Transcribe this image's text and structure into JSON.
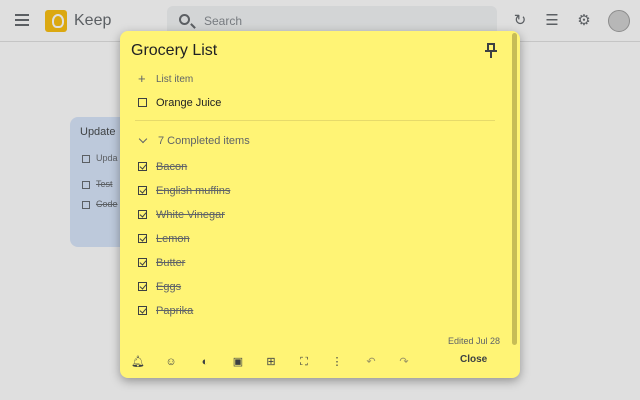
{
  "header": {
    "app_title": "Keep",
    "search_placeholder": "Search",
    "icons": [
      "menu-icon",
      "keep-logo-icon",
      "search-icon",
      "refresh-icon",
      "list-view-icon",
      "settings-icon",
      "avatar"
    ]
  },
  "background_note": {
    "title": "Update",
    "rows": [
      {
        "text": "Upda",
        "checked": false
      },
      {
        "text": "Test",
        "checked": true
      },
      {
        "text": "Code",
        "checked": true
      }
    ]
  },
  "note": {
    "title": "Grocery List",
    "add_item_placeholder": "List item",
    "active_items": [
      {
        "text": "Orange Juice",
        "checked": false
      }
    ],
    "completed_header": "7 Completed items",
    "completed_items": [
      {
        "text": "Bacon"
      },
      {
        "text": "English muffins"
      },
      {
        "text": "White Vinegar"
      },
      {
        "text": "Lemon"
      },
      {
        "text": "Butter"
      },
      {
        "text": "Eggs"
      },
      {
        "text": "Paprika"
      }
    ],
    "edited": "Edited Jul 28",
    "background_color": "#fff475",
    "toolbar": {
      "icons": [
        "remind-icon",
        "collaborator-icon",
        "palette-icon",
        "image-icon",
        "archive-icon",
        "expand-icon",
        "more-icon",
        "undo-icon",
        "redo-icon"
      ],
      "close_label": "Close"
    }
  },
  "colors": {
    "keep_yellow": "#fbbc04",
    "note_yellow": "#fff475",
    "bg_note_blue": "#d6e4fa"
  }
}
